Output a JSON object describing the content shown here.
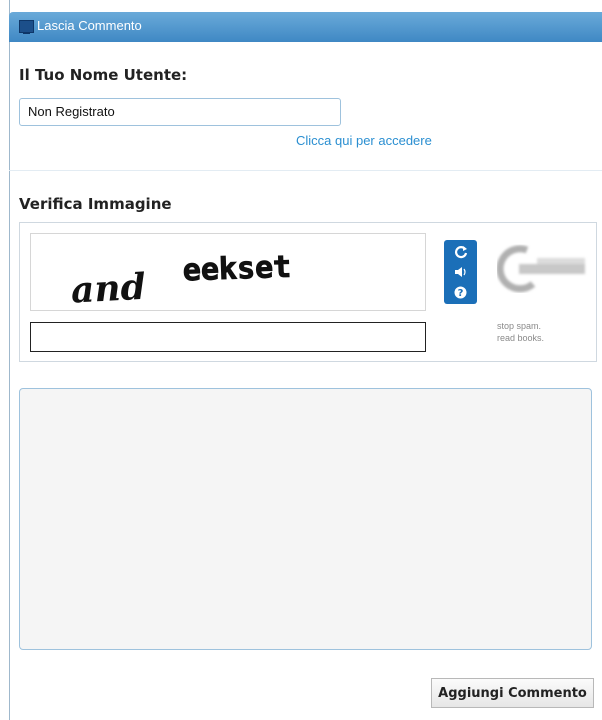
{
  "header": {
    "title": "Lascia Commento",
    "icon": "monitor-icon",
    "color": "#4a93cc"
  },
  "username": {
    "label": "Il Tuo Nome Utente:",
    "value": "Non Registrato",
    "login_link": "Clicca qui per accedere"
  },
  "captcha": {
    "label": "Verifica Immagine",
    "words": [
      "and",
      "eekset"
    ],
    "buttons": [
      {
        "icon": "refresh-icon"
      },
      {
        "icon": "audio-icon"
      },
      {
        "icon": "help-icon"
      }
    ],
    "tagline_line1": "stop spam.",
    "tagline_line2": "read books."
  },
  "comment": {
    "value": ""
  },
  "submit_label": "Aggiungi Commento"
}
